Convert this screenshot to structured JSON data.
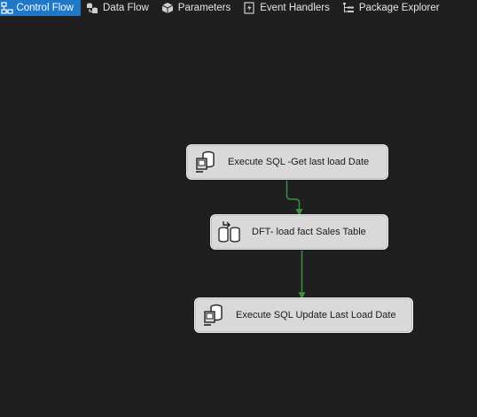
{
  "tabs": [
    {
      "label": "Control Flow",
      "icon": "control-flow-icon",
      "active": true
    },
    {
      "label": "Data Flow",
      "icon": "data-flow-icon",
      "active": false
    },
    {
      "label": "Parameters",
      "icon": "parameters-icon",
      "active": false
    },
    {
      "label": "Event Handlers",
      "icon": "event-handlers-icon",
      "active": false
    },
    {
      "label": "Package Explorer",
      "icon": "package-explorer-icon",
      "active": false
    }
  ],
  "tasks": [
    {
      "label": "Execute SQL -Get last load Date",
      "icon": "execute-sql-icon"
    },
    {
      "label": "DFT- load fact Sales Table",
      "icon": "data-flow-task-icon"
    },
    {
      "label": "Execute SQL Update Last Load Date",
      "icon": "execute-sql-icon"
    }
  ],
  "colors": {
    "background": "#1f1f1f",
    "active_tab": "#1e78c8",
    "task_fill": "#d9d9d9",
    "success_connector": "#3c8f3c"
  }
}
